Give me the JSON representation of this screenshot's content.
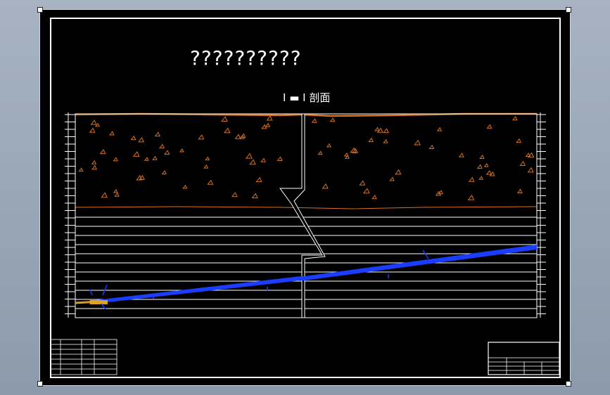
{
  "drawing": {
    "title": "??????????",
    "section_label": "I ▬ I  剖面"
  },
  "colors": {
    "soil_line": "#d8701d",
    "seam": "#1a3dff",
    "lines": "#ffffff",
    "background": "#000000"
  }
}
